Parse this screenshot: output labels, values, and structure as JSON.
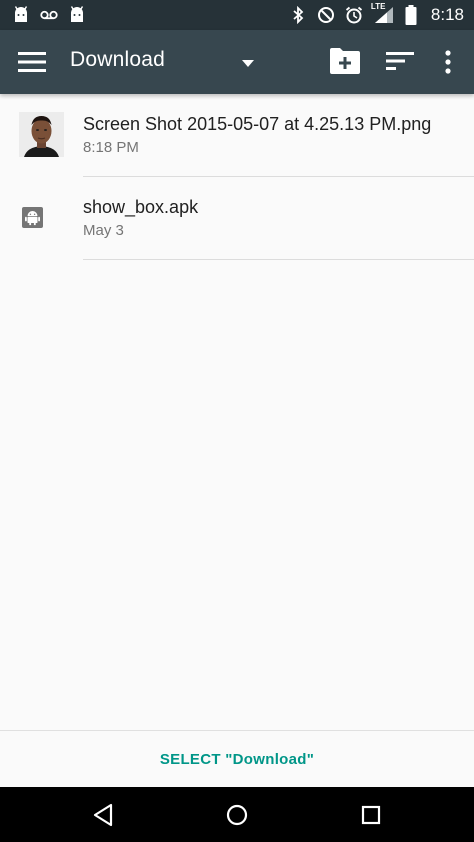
{
  "status_bar": {
    "time": "8:18",
    "network": "LTE",
    "left_icons": [
      "android-icon",
      "voicemail-icon",
      "android-icon"
    ],
    "right_icons": [
      "bluetooth-icon",
      "do-not-disturb-icon",
      "alarm-icon",
      "signal-icon",
      "battery-icon"
    ]
  },
  "app_bar": {
    "title": "Download",
    "icons": [
      "menu-icon",
      "dropdown-arrow-icon",
      "new-folder-icon",
      "sort-icon",
      "more-vert-icon"
    ],
    "color": "#37474f"
  },
  "files": [
    {
      "name": "Screen Shot 2015-05-07 at 4.25.13 PM.png",
      "date": "8:18 PM",
      "icon": "image-thumbnail"
    },
    {
      "name": "show_box.apk",
      "date": "May 3",
      "icon": "android-icon"
    }
  ],
  "bottom_bar": {
    "select_label": "SELECT \"Download\"",
    "accent": "#009688"
  },
  "nav_bar": {
    "icons": [
      "back-icon",
      "home-icon",
      "recents-icon"
    ]
  }
}
